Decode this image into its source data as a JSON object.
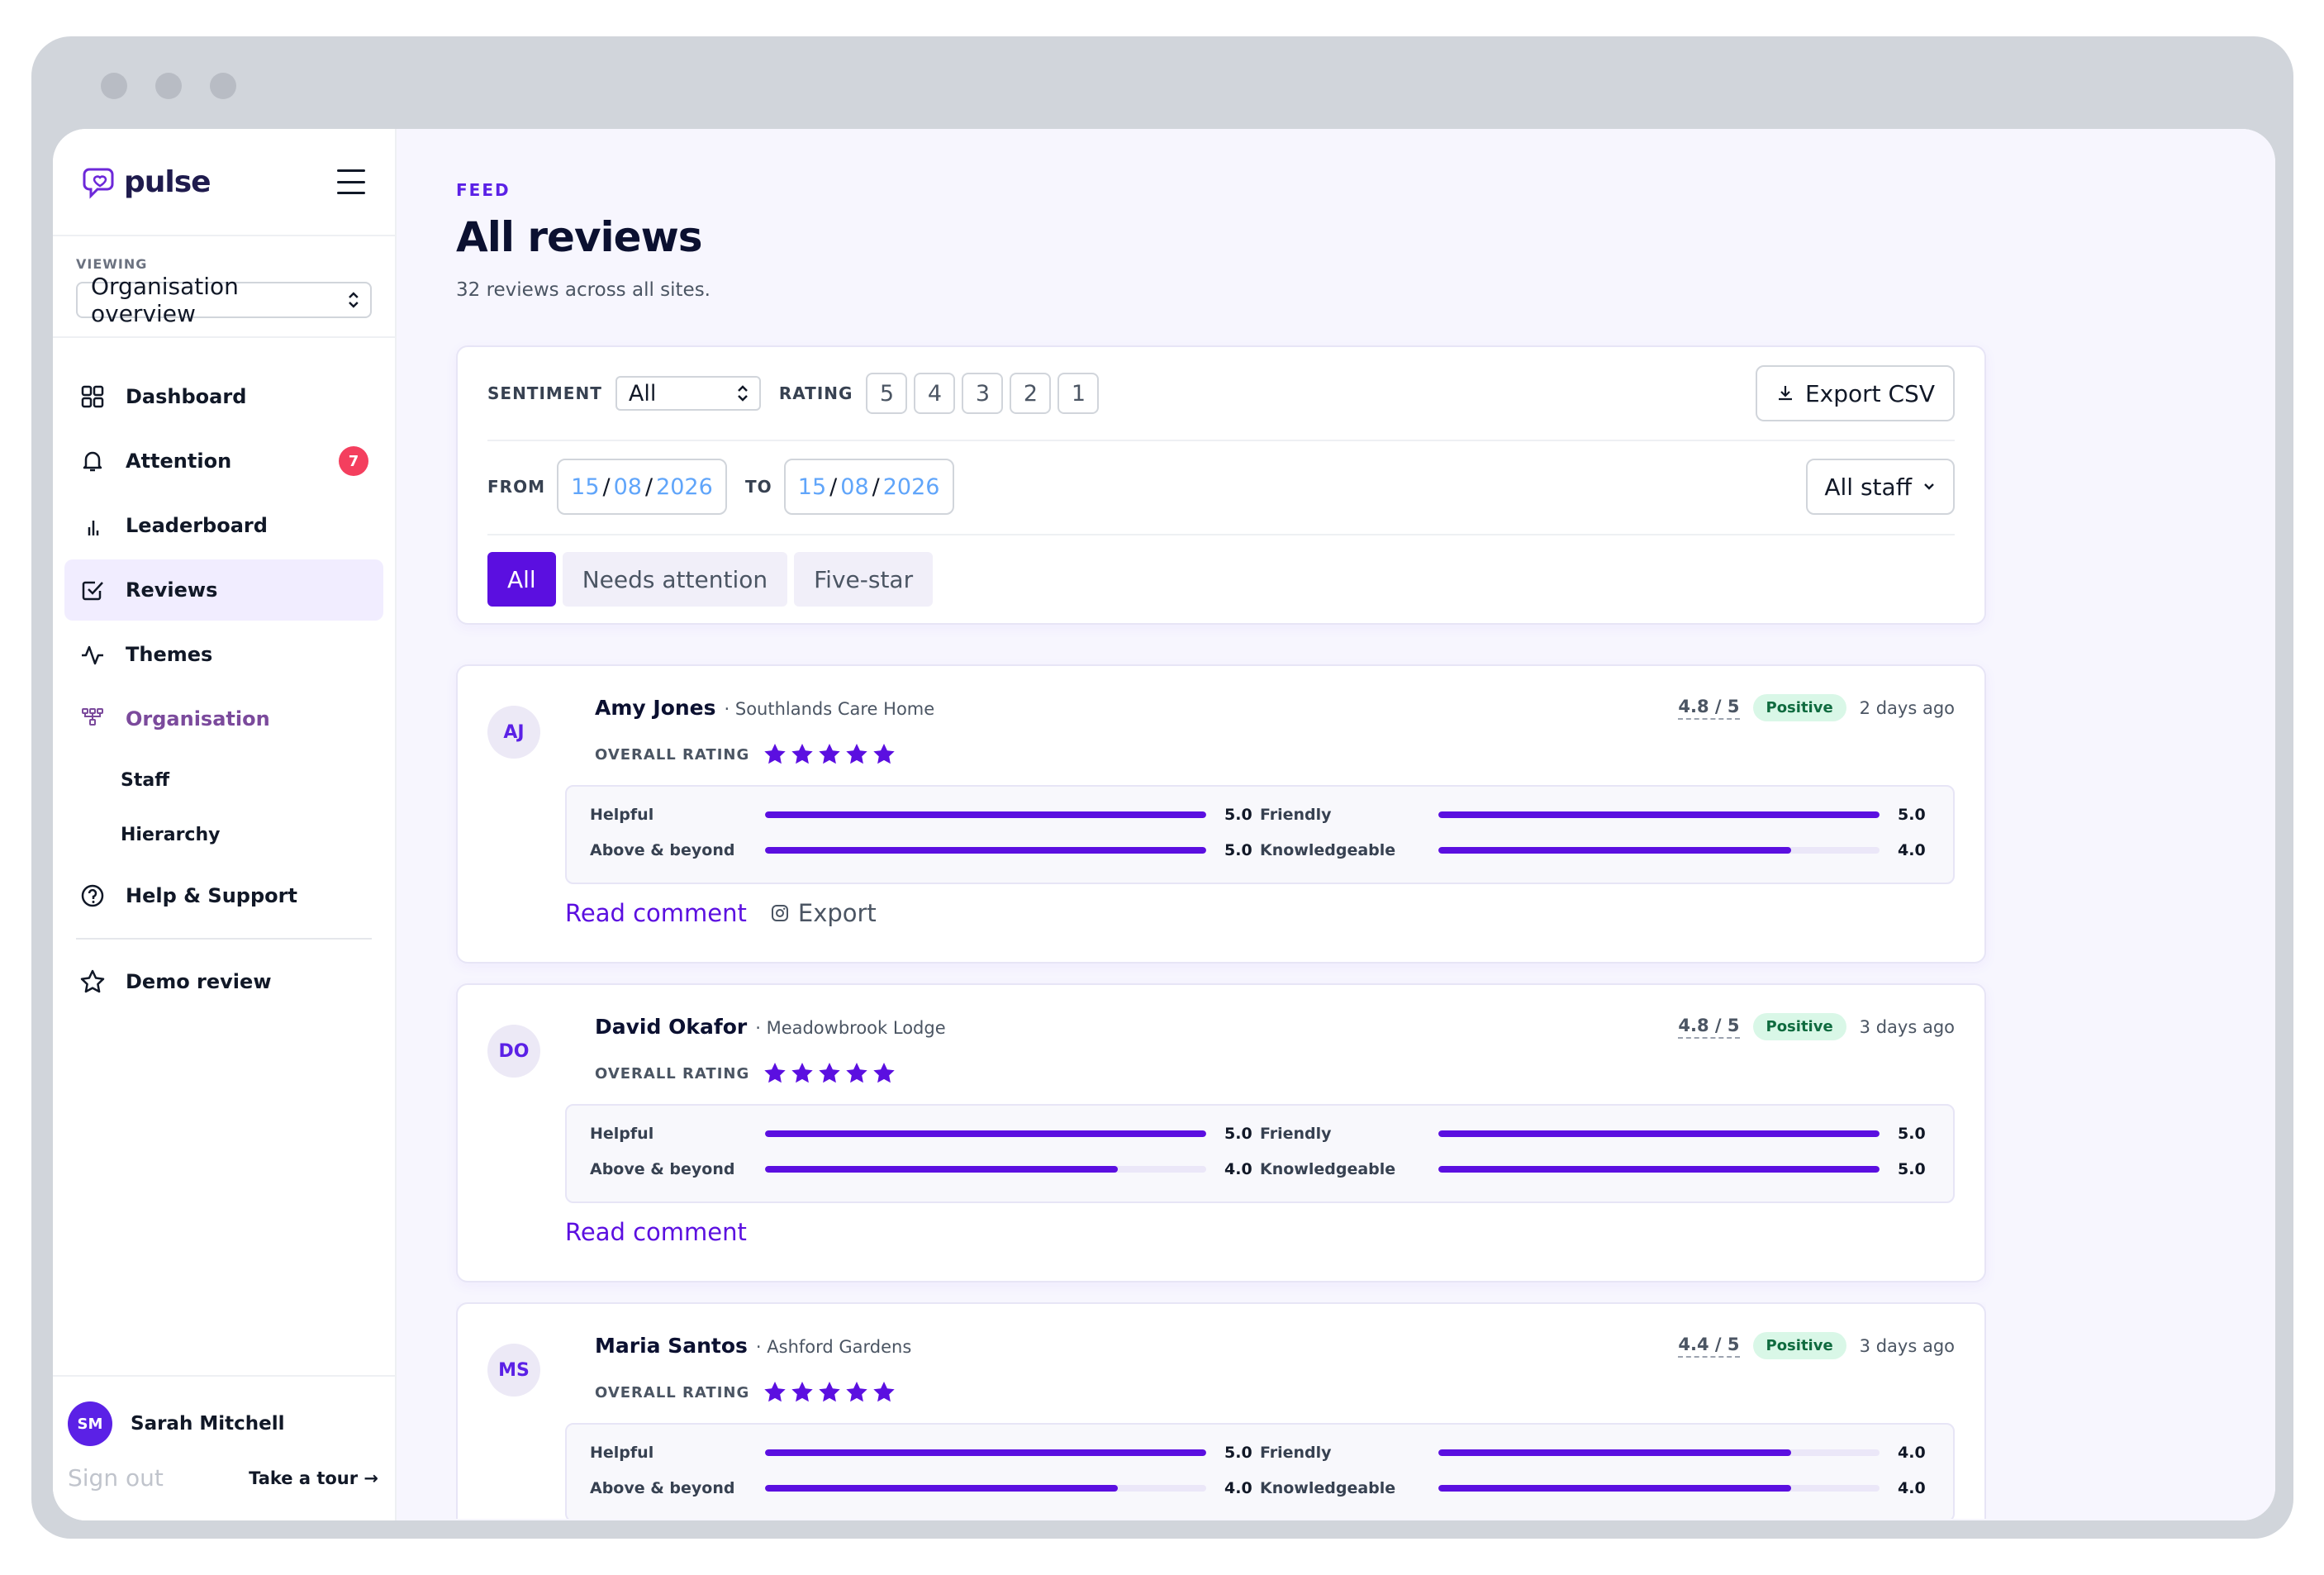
{
  "app": {
    "name": "pulse"
  },
  "sidebar": {
    "viewing_label": "VIEWING",
    "viewing_value": "Organisation overview",
    "items": [
      {
        "label": "Dashboard",
        "icon": "grid-icon"
      },
      {
        "label": "Attention",
        "icon": "bell-icon",
        "badge": "7"
      },
      {
        "label": "Leaderboard",
        "icon": "bar-chart-icon"
      },
      {
        "label": "Reviews",
        "icon": "check-square-icon",
        "active": true
      },
      {
        "label": "Themes",
        "icon": "activity-icon"
      },
      {
        "label": "Organisation",
        "icon": "org-chart-icon"
      }
    ],
    "sub_items": [
      "Staff",
      "Hierarchy"
    ],
    "help": "Help & Support",
    "demo": "Demo review",
    "user": {
      "initials": "SM",
      "name": "Sarah Mitchell",
      "sign_out": "Sign out",
      "tour": "Take a tour →"
    }
  },
  "header": {
    "eyebrow": "FEED",
    "title": "All reviews",
    "subtitle": "32 reviews across all sites."
  },
  "filters": {
    "sentiment_label": "SENTIMENT",
    "sentiment_value": "All",
    "rating_label": "RATING",
    "ratings": [
      "5",
      "4",
      "3",
      "2",
      "1"
    ],
    "export": "Export CSV",
    "from_label": "FROM",
    "to_label": "TO",
    "from": {
      "d": "15",
      "m": "08",
      "y": "2026"
    },
    "to": {
      "d": "15",
      "m": "08",
      "y": "2026"
    },
    "staff": "All staff",
    "tabs": [
      "All",
      "Needs attention",
      "Five-star"
    ]
  },
  "reviews": [
    {
      "initials": "AJ",
      "name": "Amy Jones",
      "site": "· Southlands Care Home",
      "overall_label": "OVERALL RATING",
      "stars": 5,
      "score": "4.8 / 5",
      "sentiment": "Positive",
      "ago": "2 days ago",
      "metrics": [
        {
          "name": "Helpful",
          "value": "5.0",
          "fraction": 1.0
        },
        {
          "name": "Friendly",
          "value": "5.0",
          "fraction": 1.0
        },
        {
          "name": "Above & beyond",
          "value": "5.0",
          "fraction": 1.0
        },
        {
          "name": "Knowledgeable",
          "value": "4.0",
          "fraction": 0.8
        }
      ],
      "read": "Read comment",
      "export": "Export"
    },
    {
      "initials": "DO",
      "name": "David Okafor",
      "site": "· Meadowbrook Lodge",
      "overall_label": "OVERALL RATING",
      "stars": 5,
      "score": "4.8 / 5",
      "sentiment": "Positive",
      "ago": "3 days ago",
      "metrics": [
        {
          "name": "Helpful",
          "value": "5.0",
          "fraction": 1.0
        },
        {
          "name": "Friendly",
          "value": "5.0",
          "fraction": 1.0
        },
        {
          "name": "Above & beyond",
          "value": "4.0",
          "fraction": 0.8
        },
        {
          "name": "Knowledgeable",
          "value": "5.0",
          "fraction": 1.0
        }
      ],
      "read": "Read comment"
    },
    {
      "initials": "MS",
      "name": "Maria Santos",
      "site": "· Ashford Gardens",
      "overall_label": "OVERALL RATING",
      "stars": 5,
      "score": "4.4 / 5",
      "sentiment": "Positive",
      "ago": "3 days ago",
      "metrics": [
        {
          "name": "Helpful",
          "value": "5.0",
          "fraction": 1.0
        },
        {
          "name": "Friendly",
          "value": "4.0",
          "fraction": 0.8
        },
        {
          "name": "Above & beyond",
          "value": "4.0",
          "fraction": 0.8
        },
        {
          "name": "Knowledgeable",
          "value": "4.0",
          "fraction": 0.8
        }
      ]
    }
  ],
  "colors": {
    "accent": "#5b0fe0",
    "positive_bg": "#d9f7e7",
    "badge": "#f43f5e"
  }
}
